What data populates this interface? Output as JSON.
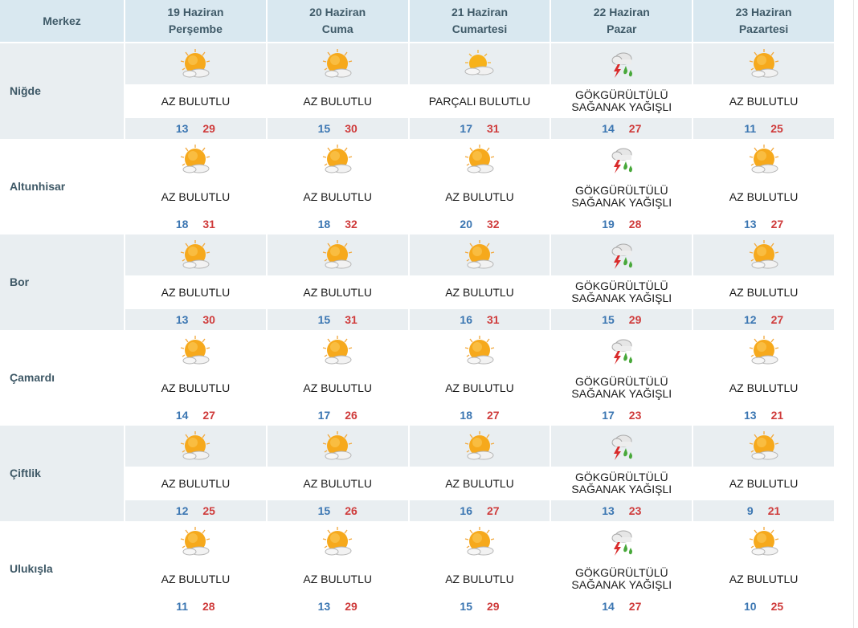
{
  "header": {
    "merkez": "Merkez",
    "days": [
      {
        "date": "19 Haziran",
        "name": "Perşembe"
      },
      {
        "date": "20 Haziran",
        "name": "Cuma"
      },
      {
        "date": "21 Haziran",
        "name": "Cumartesi"
      },
      {
        "date": "22 Haziran",
        "name": "Pazar"
      },
      {
        "date": "23 Haziran",
        "name": "Pazartesi"
      }
    ]
  },
  "colors": {
    "min": "#3b76b2",
    "max": "#cf3b3b",
    "header_bg": "#d9e8f0",
    "stripe_bg": "#e9eef1"
  },
  "rows": [
    {
      "city": "Niğde",
      "days": [
        {
          "icon": "partly-sunny-icon",
          "cond": [
            "AZ BULUTLU"
          ],
          "min": "13",
          "max": "29"
        },
        {
          "icon": "partly-sunny-icon",
          "cond": [
            "AZ BULUTLU"
          ],
          "min": "15",
          "max": "30"
        },
        {
          "icon": "partly-cloudy-icon",
          "cond": [
            "PARÇALI BULUTLU"
          ],
          "min": "17",
          "max": "31"
        },
        {
          "icon": "thunderstorm-icon",
          "cond": [
            "GÖKGÜRÜLTÜLÜ",
            "SAĞANAK YAĞIŞLI"
          ],
          "min": "14",
          "max": "27"
        },
        {
          "icon": "partly-sunny-icon",
          "cond": [
            "AZ BULUTLU"
          ],
          "min": "11",
          "max": "25"
        }
      ]
    },
    {
      "city": "Altunhisar",
      "days": [
        {
          "icon": "partly-sunny-icon",
          "cond": [
            "AZ BULUTLU"
          ],
          "min": "18",
          "max": "31"
        },
        {
          "icon": "partly-sunny-icon",
          "cond": [
            "AZ BULUTLU"
          ],
          "min": "18",
          "max": "32"
        },
        {
          "icon": "partly-sunny-icon",
          "cond": [
            "AZ BULUTLU"
          ],
          "min": "20",
          "max": "32"
        },
        {
          "icon": "thunderstorm-icon",
          "cond": [
            "GÖKGÜRÜLTÜLÜ",
            "SAĞANAK YAĞIŞLI"
          ],
          "min": "19",
          "max": "28"
        },
        {
          "icon": "partly-sunny-icon",
          "cond": [
            "AZ BULUTLU"
          ],
          "min": "13",
          "max": "27"
        }
      ]
    },
    {
      "city": "Bor",
      "days": [
        {
          "icon": "partly-sunny-icon",
          "cond": [
            "AZ BULUTLU"
          ],
          "min": "13",
          "max": "30"
        },
        {
          "icon": "partly-sunny-icon",
          "cond": [
            "AZ BULUTLU"
          ],
          "min": "15",
          "max": "31"
        },
        {
          "icon": "partly-sunny-icon",
          "cond": [
            "AZ BULUTLU"
          ],
          "min": "16",
          "max": "31"
        },
        {
          "icon": "thunderstorm-icon",
          "cond": [
            "GÖKGÜRÜLTÜLÜ",
            "SAĞANAK YAĞIŞLI"
          ],
          "min": "15",
          "max": "29"
        },
        {
          "icon": "partly-sunny-icon",
          "cond": [
            "AZ BULUTLU"
          ],
          "min": "12",
          "max": "27"
        }
      ]
    },
    {
      "city": "Çamardı",
      "days": [
        {
          "icon": "partly-sunny-icon",
          "cond": [
            "AZ BULUTLU"
          ],
          "min": "14",
          "max": "27"
        },
        {
          "icon": "partly-sunny-icon",
          "cond": [
            "AZ BULUTLU"
          ],
          "min": "17",
          "max": "26"
        },
        {
          "icon": "partly-sunny-icon",
          "cond": [
            "AZ BULUTLU"
          ],
          "min": "18",
          "max": "27"
        },
        {
          "icon": "thunderstorm-icon",
          "cond": [
            "GÖKGÜRÜLTÜLÜ",
            "SAĞANAK YAĞIŞLI"
          ],
          "min": "17",
          "max": "23"
        },
        {
          "icon": "partly-sunny-icon",
          "cond": [
            "AZ BULUTLU"
          ],
          "min": "13",
          "max": "21"
        }
      ]
    },
    {
      "city": "Çiftlik",
      "days": [
        {
          "icon": "partly-sunny-icon",
          "cond": [
            "AZ BULUTLU"
          ],
          "min": "12",
          "max": "25"
        },
        {
          "icon": "partly-sunny-icon",
          "cond": [
            "AZ BULUTLU"
          ],
          "min": "15",
          "max": "26"
        },
        {
          "icon": "partly-sunny-icon",
          "cond": [
            "AZ BULUTLU"
          ],
          "min": "16",
          "max": "27"
        },
        {
          "icon": "thunderstorm-icon",
          "cond": [
            "GÖKGÜRÜLTÜLÜ",
            "SAĞANAK YAĞIŞLI"
          ],
          "min": "13",
          "max": "23"
        },
        {
          "icon": "partly-sunny-icon",
          "cond": [
            "AZ BULUTLU"
          ],
          "min": "9",
          "max": "21"
        }
      ]
    },
    {
      "city": "Ulukışla",
      "days": [
        {
          "icon": "partly-sunny-icon",
          "cond": [
            "AZ BULUTLU"
          ],
          "min": "11",
          "max": "28"
        },
        {
          "icon": "partly-sunny-icon",
          "cond": [
            "AZ BULUTLU"
          ],
          "min": "13",
          "max": "29"
        },
        {
          "icon": "partly-sunny-icon",
          "cond": [
            "AZ BULUTLU"
          ],
          "min": "15",
          "max": "29"
        },
        {
          "icon": "thunderstorm-icon",
          "cond": [
            "GÖKGÜRÜLTÜLÜ",
            "SAĞANAK YAĞIŞLI"
          ],
          "min": "14",
          "max": "27"
        },
        {
          "icon": "partly-sunny-icon",
          "cond": [
            "AZ BULUTLU"
          ],
          "min": "10",
          "max": "25"
        }
      ]
    }
  ]
}
